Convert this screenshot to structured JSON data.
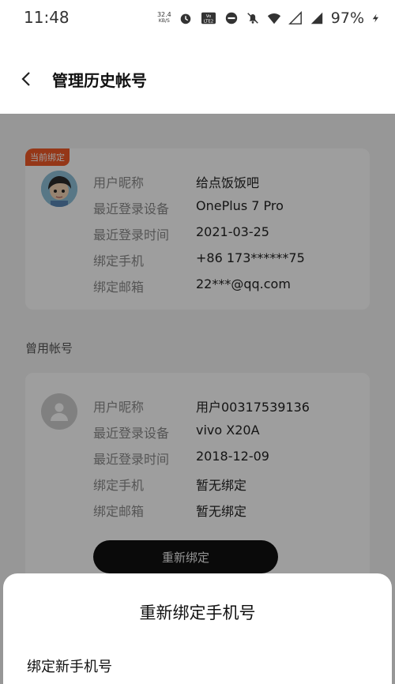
{
  "status_bar": {
    "time": "11:48",
    "net_speed_value": "32.4",
    "net_speed_unit": "KB/S",
    "volte_label": "Vo LTE 2",
    "battery": "97%",
    "icons": [
      "alarm-icon",
      "volte-icon",
      "dnd-icon",
      "mute-icon",
      "wifi-icon",
      "signal-icon",
      "signal-4g-icon",
      "charging-icon"
    ]
  },
  "header": {
    "title": "管理历史帐号"
  },
  "current_account": {
    "tag": "当前绑定",
    "rows": [
      {
        "label": "用户昵称",
        "value": "给点饭饭吧"
      },
      {
        "label": "最近登录设备",
        "value": "OnePlus 7 Pro"
      },
      {
        "label": "最近登录时间",
        "value": "2021-03-25"
      },
      {
        "label": "绑定手机",
        "value": "+86 173******75"
      },
      {
        "label": "绑定邮箱",
        "value": "22***@qq.com"
      }
    ]
  },
  "used_section_title": "曾用帐号",
  "used_account": {
    "rows": [
      {
        "label": "用户昵称",
        "value": "用户00317539136"
      },
      {
        "label": "最近登录设备",
        "value": "vivo X20A"
      },
      {
        "label": "最近登录时间",
        "value": "2018-12-09"
      },
      {
        "label": "绑定手机",
        "value": "暂无绑定"
      },
      {
        "label": "绑定邮箱",
        "value": "暂无绑定"
      }
    ],
    "button_label": "重新绑定"
  },
  "sheet": {
    "title": "重新绑定手机号",
    "field_label": "绑定新手机号"
  },
  "colors": {
    "accent": "#f05a28",
    "button": "#111111"
  }
}
